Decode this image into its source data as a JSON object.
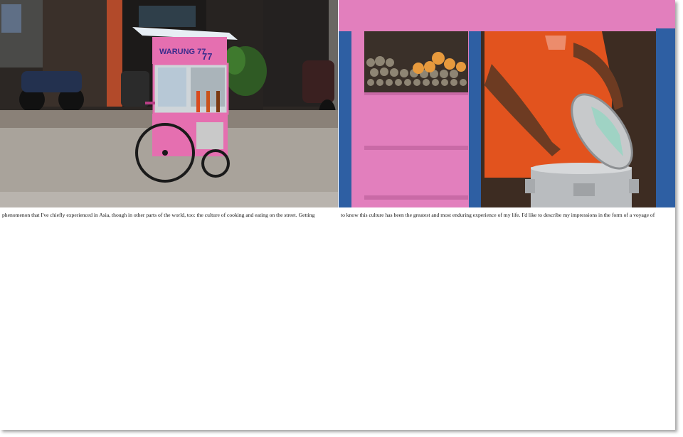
{
  "cart_sign": {
    "name": "WARUNG 77",
    "number": "77"
  },
  "text": {
    "left_column": "phenomenon that I've chiefly experienced in Asia, though in other parts of the world, too: the culture of cooking and eating on the street. Getting",
    "right_column": "to know this culture has been the greatest and most enduring experience of my life. I'd like to describe my impressions in the form of a voyage of"
  }
}
